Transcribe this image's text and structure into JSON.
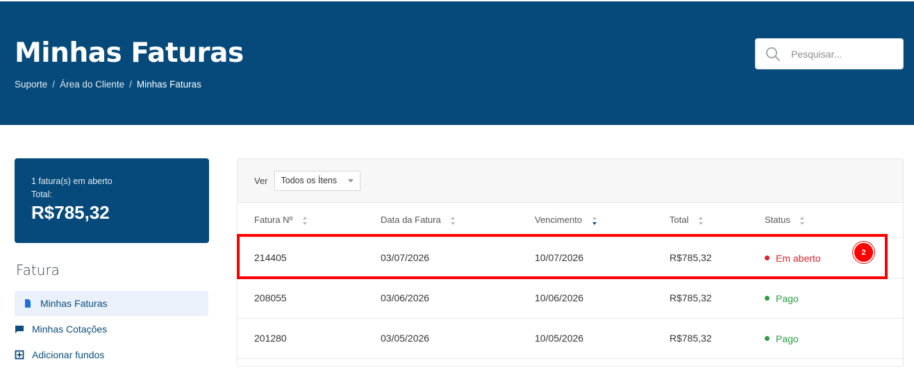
{
  "header": {
    "title": "Minhas Faturas",
    "breadcrumb": [
      "Suporte",
      "Área do Cliente",
      "Minhas Faturas"
    ],
    "search_placeholder": "Pesquisar...",
    "background_color": "#054a7a"
  },
  "summary": {
    "open_count_text": "1 fatura(s) em aberto",
    "total_label": "Total:",
    "total_amount": "R$785,32"
  },
  "sidebar": {
    "section_title": "Fatura",
    "items": [
      {
        "label": "Minhas Faturas",
        "icon": "document-icon",
        "active": true
      },
      {
        "label": "Minhas Cotações",
        "icon": "comment-icon",
        "active": false
      },
      {
        "label": "Adicionar fundos",
        "icon": "add-funds-icon",
        "active": false
      }
    ]
  },
  "filter": {
    "label": "Ver",
    "selected": "Todos os Ítens"
  },
  "table": {
    "columns": [
      "Fatura Nº",
      "Data da Fatura",
      "Vencimento",
      "Total",
      "Status"
    ],
    "rows": [
      {
        "number": "214405",
        "date": "03/07/2026",
        "due": "10/07/2026",
        "total": "R$785,32",
        "status": "Em aberto",
        "status_color": "#d9262e"
      },
      {
        "number": "208055",
        "date": "03/06/2026",
        "due": "10/06/2026",
        "total": "R$785,32",
        "status": "Pago",
        "status_color": "#2e9c43"
      },
      {
        "number": "201280",
        "date": "03/05/2026",
        "due": "10/05/2026",
        "total": "R$785,32",
        "status": "Pago",
        "status_color": "#2e9c43"
      }
    ]
  },
  "annotation": {
    "badge": "2",
    "highlight_color": "#ff0000"
  }
}
